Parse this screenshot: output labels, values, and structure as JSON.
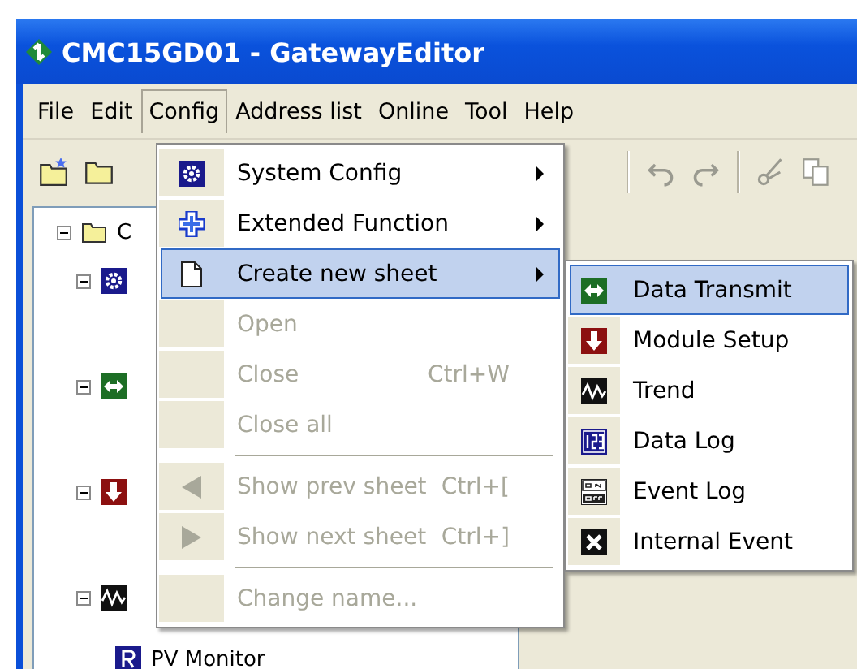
{
  "window": {
    "title": "CMC15GD01 - GatewayEditor"
  },
  "menu_bar": [
    {
      "label": "File",
      "selected": false
    },
    {
      "label": "Edit",
      "selected": false
    },
    {
      "label": "Config",
      "selected": true
    },
    {
      "label": "Address list",
      "selected": false
    },
    {
      "label": "Online",
      "selected": false
    },
    {
      "label": "Tool",
      "selected": false
    },
    {
      "label": "Help",
      "selected": false
    }
  ],
  "tree": {
    "root": {
      "label": "C",
      "expanded": true
    },
    "children": [
      {
        "expanded": true
      },
      {
        "expanded": true
      },
      {
        "expanded": true
      },
      {
        "expanded": true,
        "children": [
          {
            "label": "PV Monitor"
          }
        ]
      }
    ]
  },
  "config_menu": [
    {
      "kind": "item",
      "label": "System Config",
      "submenu": true,
      "disabled": false,
      "selected": false
    },
    {
      "kind": "item",
      "label": "Extended Function",
      "submenu": true,
      "disabled": false,
      "selected": false
    },
    {
      "kind": "item",
      "label": "Create new sheet",
      "submenu": true,
      "disabled": false,
      "selected": true
    },
    {
      "kind": "item",
      "label": "Open",
      "submenu": false,
      "disabled": true,
      "selected": false
    },
    {
      "kind": "item",
      "label": "Close",
      "shortcut": "Ctrl+W",
      "submenu": false,
      "disabled": true,
      "selected": false
    },
    {
      "kind": "item",
      "label": "Close all",
      "submenu": false,
      "disabled": true,
      "selected": false
    },
    {
      "kind": "separator"
    },
    {
      "kind": "item",
      "label": "Show prev sheet",
      "shortcut": "Ctrl+[",
      "submenu": false,
      "disabled": true,
      "selected": false
    },
    {
      "kind": "item",
      "label": "Show next sheet",
      "shortcut": "Ctrl+]",
      "submenu": false,
      "disabled": true,
      "selected": false
    },
    {
      "kind": "separator"
    },
    {
      "kind": "item",
      "label": "Change name...",
      "submenu": false,
      "disabled": true,
      "selected": false
    }
  ],
  "submenu": [
    {
      "label": "Data Transmit",
      "selected": true
    },
    {
      "label": "Module Setup",
      "selected": false
    },
    {
      "label": "Trend",
      "selected": false
    },
    {
      "label": "Data Log",
      "selected": false
    },
    {
      "label": "Event Log",
      "selected": false
    },
    {
      "label": "Internal Event",
      "selected": false
    }
  ]
}
